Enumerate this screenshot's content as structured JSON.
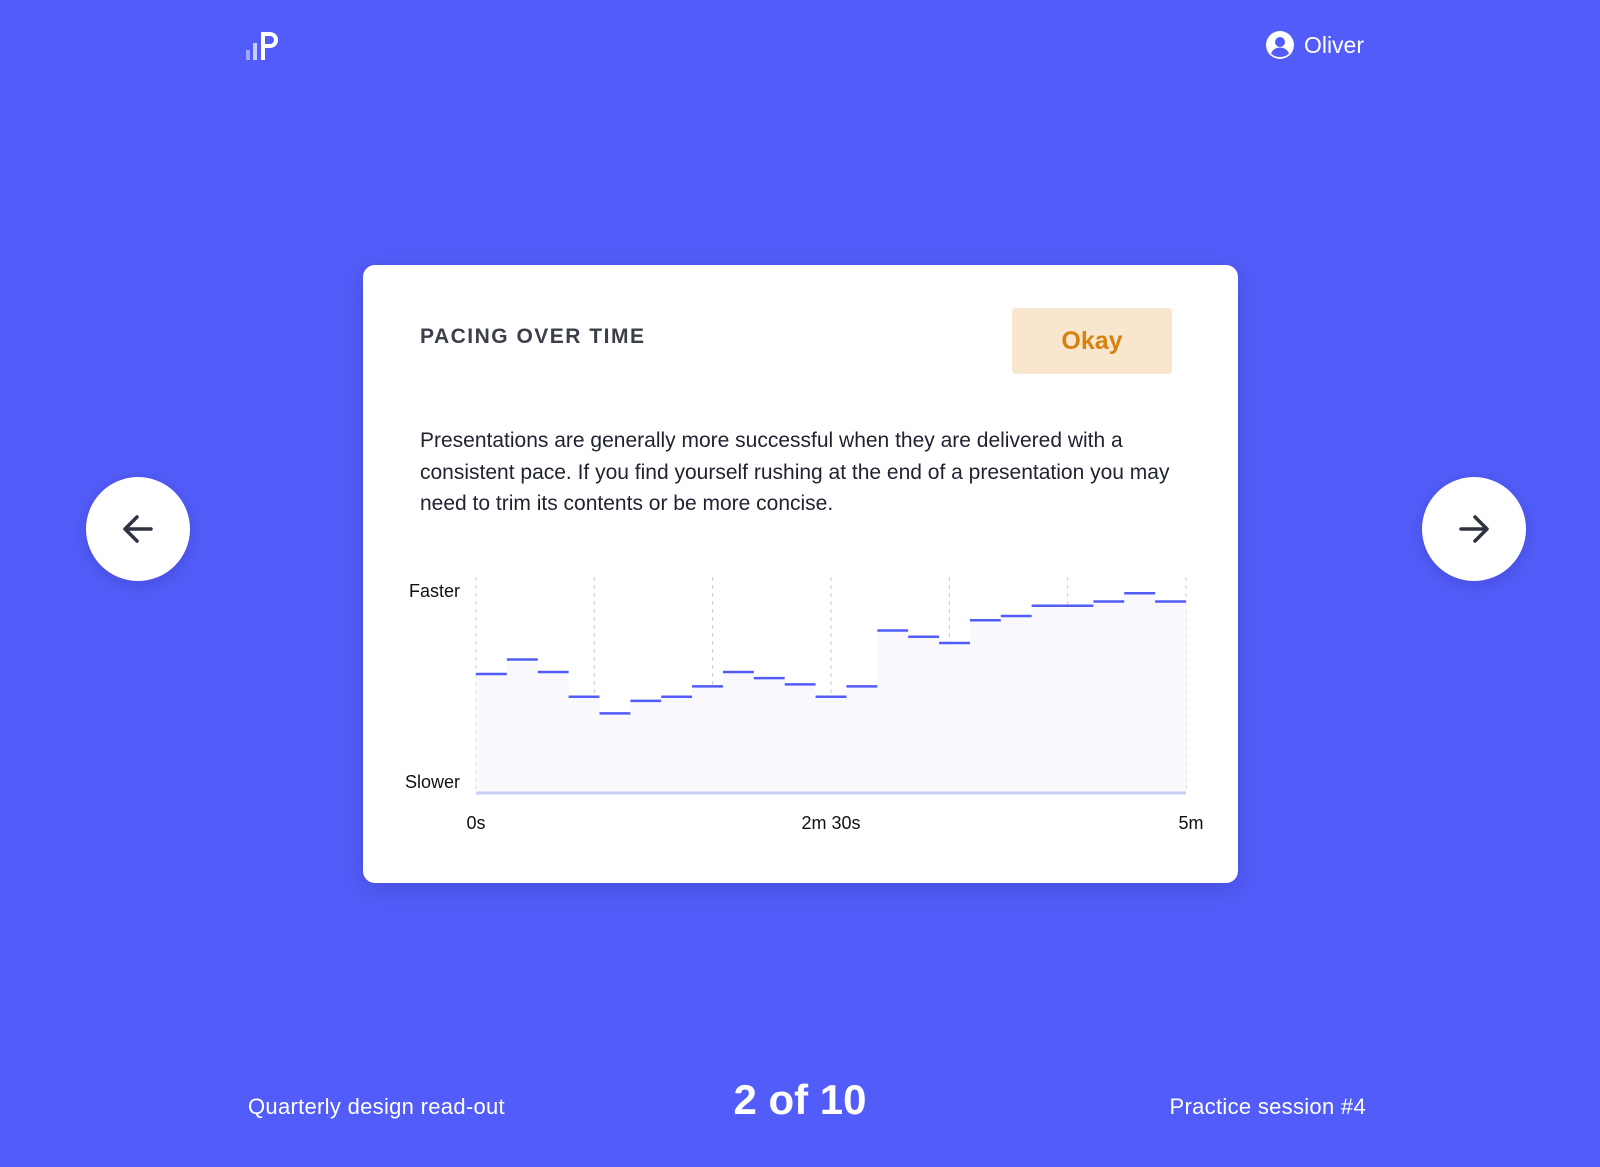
{
  "header": {
    "logo_icon": "bars-p-logo-icon",
    "user_icon": "user-avatar-icon",
    "user_name": "Oliver"
  },
  "navigation": {
    "prev_icon": "arrow-left-icon",
    "next_icon": "arrow-right-icon"
  },
  "card": {
    "title": "PACING OVER TIME",
    "rating_label": "Okay",
    "rating_color": "#D6820E",
    "rating_bg_color": "#F9E6CF",
    "description": "Presentations are generally more successful when they are delivered with a consistent pace. If you find yourself rushing at the end of a presentation you may need to trim its contents or be more concise."
  },
  "chart_data": {
    "type": "step",
    "y_tick_labels": [
      "Faster",
      "Slower"
    ],
    "x_tick_labels": [
      "0s",
      "2m 30s",
      "5m"
    ],
    "x_range_seconds": [
      0,
      300
    ],
    "y_range": [
      0,
      1
    ],
    "grid": "vertical dashed lines every 50 seconds",
    "line_color": "#525CF8",
    "values": [
      0.57,
      0.64,
      0.58,
      0.46,
      0.38,
      0.44,
      0.46,
      0.51,
      0.58,
      0.55,
      0.52,
      0.46,
      0.51,
      0.78,
      0.75,
      0.72,
      0.83,
      0.85,
      0.9,
      0.9,
      0.92,
      0.96,
      0.92
    ]
  },
  "footer": {
    "presentation_name": "Quarterly design read-out",
    "page_counter": "2 of 10",
    "session_label": "Practice session #4"
  },
  "colors": {
    "background": "#525CF8",
    "card": "#FFFFFF"
  }
}
